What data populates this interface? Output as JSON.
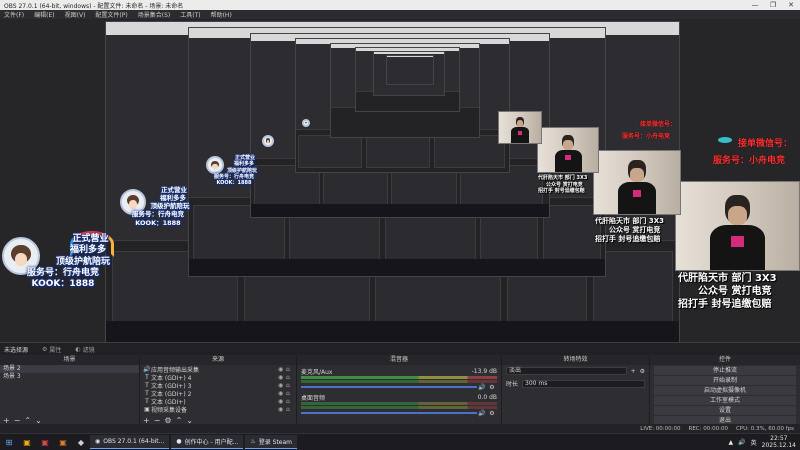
{
  "window": {
    "title": "OBS 27.0.1 (64-bit, windows) - 配置文件: 未命名 - 场景: 未命名",
    "controls": [
      "—",
      "❐",
      "✕"
    ]
  },
  "menu": [
    "文件(F)",
    "编辑(E)",
    "视图(V)",
    "配置文件(P)",
    "场景集合(S)",
    "工具(T)",
    "帮助(H)"
  ],
  "overlay": {
    "line1": "正式营业",
    "line2": "福利多多",
    "line3": "顶级护航陪玩",
    "line4": "服务号：行舟电竞",
    "line5": "KOOK：1888"
  },
  "camera": {
    "red_lines": [
      "接单微信号：",
      "服务号：小舟电竞"
    ],
    "caption1": "代肝陷天市 部门 3X3",
    "caption2": "公众号 赏打电竞",
    "caption3": "招打手 封号追缴包赔"
  },
  "scene_bar": {
    "label": "未选择源",
    "properties": "属性",
    "filters": "滤镜"
  },
  "scenes": {
    "title": "场景",
    "items": [
      "场景 2",
      "场景 3"
    ]
  },
  "sources": {
    "title": "来源",
    "items": [
      {
        "icon": "🔊",
        "name": "应用音频输出采集"
      },
      {
        "icon": "T",
        "name": "文本 (GDI+) 4"
      },
      {
        "icon": "T",
        "name": "文本 (GDI+) 3"
      },
      {
        "icon": "T",
        "name": "文本 (GDI+) 2"
      },
      {
        "icon": "T",
        "name": "文本 (GDI+)"
      },
      {
        "icon": "▣",
        "name": "视频采集设备"
      }
    ]
  },
  "mixer": {
    "title": "混音器",
    "channels": [
      {
        "name": "麦克风/Aux",
        "db": "-13.9 dB"
      },
      {
        "name": "桌面音频",
        "db": "0.0 dB"
      }
    ]
  },
  "transitions": {
    "title": "转场特效",
    "type": "淡出",
    "duration_label": "时长",
    "duration_value": "300 ms"
  },
  "controls": {
    "title": "控件",
    "buttons": [
      "停止推流",
      "开始录制",
      "启动虚拟摄像机",
      "工作室模式",
      "设置",
      "退出"
    ]
  },
  "status": {
    "live": "LIVE: 00:00:00",
    "rec": "REC: 00:00:00",
    "cpu": "CPU: 0.3%, 60.00 fps"
  },
  "taskbar": {
    "apps": [
      {
        "icon": "◉",
        "label": "OBS 27.0.1 (64-bit..."
      },
      {
        "icon": "●",
        "label": "创作中心 - 用户配..."
      },
      {
        "icon": "♨",
        "label": "登录 Steam"
      }
    ],
    "lang": "英",
    "time": "22:57",
    "date": "2025.12.14"
  }
}
